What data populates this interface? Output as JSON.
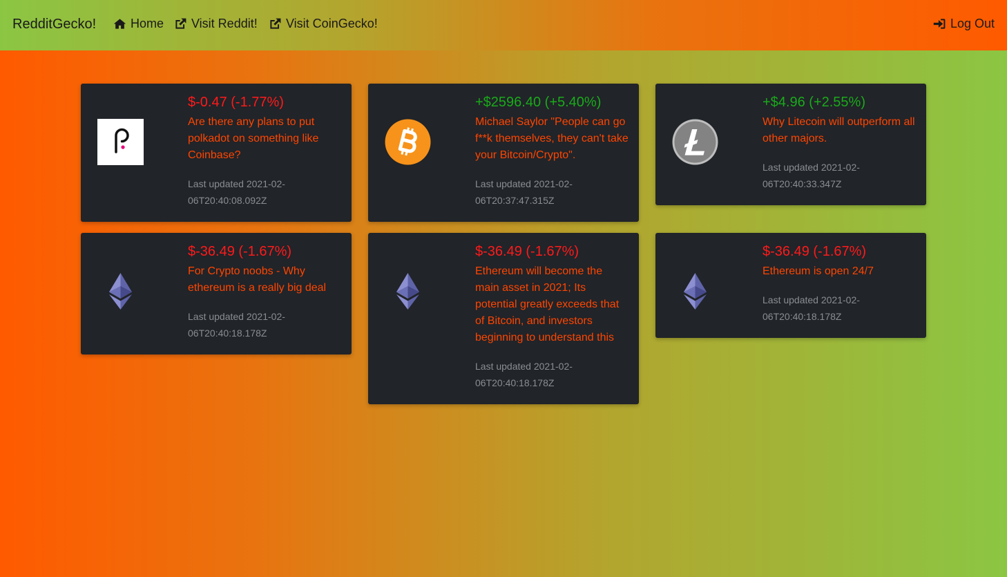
{
  "nav": {
    "brand": "RedditGecko!",
    "home": "Home",
    "visit_reddit": "Visit Reddit!",
    "visit_coingecko": "Visit CoinGecko!",
    "logout": "Log Out"
  },
  "colors": {
    "accent": "#ff4500",
    "negative": "#ff1a1a",
    "positive": "#1aaa1a",
    "card_bg": "#212429"
  },
  "cards": [
    {
      "coin_icon": "polkadot-logo-icon",
      "price_change": "$-0.47 (-1.77%)",
      "title": "Are there any plans to put polkadot on something like Coinbase?",
      "updated_line1": "Last updated 2021-02-",
      "updated_line2": "06T20:40:08.092Z"
    },
    {
      "coin_icon": "bitcoin-logo-icon",
      "price_change": "+$2596.40 (+5.40%)",
      "title": "Michael Saylor \"People can go f**k themselves, they can't take your Bitcoin/Crypto\".",
      "updated_line1": "Last updated 2021-02-",
      "updated_line2": "06T20:37:47.315Z"
    },
    {
      "coin_icon": "litecoin-logo-icon",
      "price_change": "+$4.96 (+2.55%)",
      "title": "Why Litecoin will outperform all other majors.",
      "updated_line1": "Last updated 2021-02-",
      "updated_line2": "06T20:40:33.347Z"
    },
    {
      "coin_icon": "ethereum-logo-icon",
      "price_change": "$-36.49 (-1.67%)",
      "title": "For Crypto noobs - Why ethereum is a really big deal",
      "updated_line1": "Last updated 2021-02-",
      "updated_line2": "06T20:40:18.178Z"
    },
    {
      "coin_icon": "ethereum-logo-icon",
      "price_change": "$-36.49 (-1.67%)",
      "title": "Ethereum will become the main asset in 2021; Its potential greatly exceeds that of Bitcoin, and investors beginning to understand this",
      "updated_line1": "Last updated 2021-02-",
      "updated_line2": "06T20:40:18.178Z"
    },
    {
      "coin_icon": "ethereum-logo-icon",
      "price_change": "$-36.49 (-1.67%)",
      "title": "Ethereum is open 24/7",
      "updated_line1": "Last updated 2021-02-",
      "updated_line2": "06T20:40:18.178Z"
    }
  ]
}
